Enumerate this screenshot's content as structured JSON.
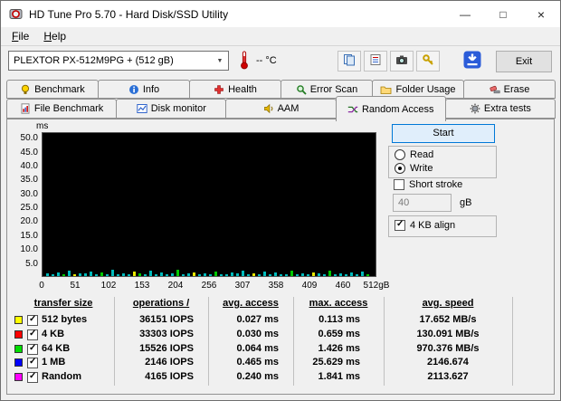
{
  "window": {
    "title": "HD Tune Pro 5.70 - Hard Disk/SSD Utility",
    "controls": {
      "minimize": "—",
      "maximize": "□",
      "close": "×"
    }
  },
  "menu": {
    "items": [
      "File",
      "Help"
    ]
  },
  "toolbar": {
    "drive_selected": "PLEXTOR PX-512M9PG + (512 gB)",
    "temperature": "-- °C",
    "buttons": [
      {
        "name": "copy-to-clipboard-button",
        "icon": "copy-icon"
      },
      {
        "name": "copy-report-button",
        "icon": "report-icon"
      },
      {
        "name": "screenshot-button",
        "icon": "camera-icon"
      },
      {
        "name": "registration-button",
        "icon": "keys-icon"
      }
    ],
    "save_icon": "save-results-icon",
    "exit_label": "Exit"
  },
  "tabs": {
    "row1": [
      {
        "label": "Benchmark",
        "icon": "benchmark-icon"
      },
      {
        "label": "Info",
        "icon": "info-icon"
      },
      {
        "label": "Health",
        "icon": "health-icon"
      },
      {
        "label": "Error Scan",
        "icon": "error-scan-icon"
      },
      {
        "label": "Folder Usage",
        "icon": "folder-usage-icon"
      },
      {
        "label": "Erase",
        "icon": "erase-icon"
      }
    ],
    "row2": [
      {
        "label": "File Benchmark",
        "icon": "file-benchmark-icon"
      },
      {
        "label": "Disk monitor",
        "icon": "disk-monitor-icon"
      },
      {
        "label": "AAM",
        "icon": "aam-icon"
      },
      {
        "label": "Random Access",
        "icon": "random-access-icon",
        "active": true
      },
      {
        "label": "Extra tests",
        "icon": "extra-tests-icon"
      }
    ]
  },
  "controls": {
    "start_label": "Start",
    "read_label": "Read",
    "write_label": "Write",
    "read_selected": false,
    "write_selected": true,
    "short_stroke_label": "Short stroke",
    "short_stroke_checked": false,
    "short_stroke_value": "40",
    "short_stroke_unit": "gB",
    "align_label": "4 KB align",
    "align_checked": true
  },
  "chart_data": {
    "type": "line",
    "title": "Random Access write latency vs disk position",
    "ylabel": "ms",
    "y_ticks": [
      50.0,
      45.0,
      40.0,
      35.0,
      30.0,
      25.0,
      20.0,
      15.0,
      10.0,
      5.0
    ],
    "ylim": [
      0,
      52
    ],
    "x_ticks": [
      "0",
      "51",
      "102",
      "153",
      "204",
      "256",
      "307",
      "358",
      "409",
      "460",
      "512gB"
    ],
    "xlim": [
      0,
      512
    ],
    "grid": false,
    "legend": "none",
    "plot_background": "#000000",
    "note": "access-time spikes hug the baseline, nearly all below 2.5 ms",
    "spike_colors": [
      "#00bcbc",
      "#00c800",
      "#e8e800"
    ],
    "spike_heights_ms": [
      1.0,
      0.6,
      1.4,
      0.8,
      2.0,
      0.5,
      1.1,
      0.9,
      1.6,
      0.7,
      1.3,
      0.6,
      2.2,
      0.8,
      1.0,
      0.5,
      1.5,
      0.9,
      0.6,
      1.8,
      0.7,
      1.2,
      0.5,
      1.0,
      2.4,
      0.6,
      0.9,
      1.4,
      0.7,
      1.1,
      0.5,
      1.7,
      0.8,
      0.6,
      1.3,
      0.9,
      2.0,
      0.5,
      1.0,
      0.7,
      1.5,
      0.6,
      1.2,
      0.8,
      0.5,
      1.9,
      0.7,
      1.1,
      0.6,
      1.4,
      0.9,
      0.5,
      2.1,
      0.8,
      1.0,
      0.6,
      1.3,
      0.7,
      1.6,
      0.5
    ],
    "spike_color_idx": [
      0,
      0,
      0,
      1,
      0,
      2,
      0,
      0,
      0,
      0,
      1,
      0,
      0,
      0,
      0,
      0,
      2,
      1,
      0,
      0,
      0,
      0,
      0,
      0,
      1,
      0,
      0,
      2,
      0,
      0,
      0,
      1,
      0,
      0,
      0,
      0,
      0,
      0,
      2,
      0,
      0,
      0,
      0,
      0,
      0,
      1,
      0,
      0,
      0,
      2,
      0,
      0,
      1,
      0,
      0,
      0,
      0,
      0,
      0,
      1
    ]
  },
  "results": {
    "headers": [
      "transfer size",
      "operations /",
      "avg. access",
      "max. access",
      "avg. speed"
    ],
    "rows": [
      {
        "color": "#ffff00",
        "checked": true,
        "size": "512 bytes",
        "operations": "36151 IOPS",
        "avg_access": "0.027 ms",
        "max_access": "0.113 ms",
        "avg_speed": "17.652 MB/s"
      },
      {
        "color": "#ff0000",
        "checked": true,
        "size": "4 KB",
        "operations": "33303 IOPS",
        "avg_access": "0.030 ms",
        "max_access": "0.659 ms",
        "avg_speed": "130.091 MB/s"
      },
      {
        "color": "#00dd00",
        "checked": true,
        "size": "64 KB",
        "operations": "15526 IOPS",
        "avg_access": "0.064 ms",
        "max_access": "1.426 ms",
        "avg_speed": "970.376 MB/s"
      },
      {
        "color": "#0000ff",
        "checked": true,
        "size": "1 MB",
        "operations": "2146 IOPS",
        "avg_access": "0.465 ms",
        "max_access": "25.629 ms",
        "avg_speed": "2146.674"
      },
      {
        "color": "#ff00ff",
        "checked": true,
        "size": "Random",
        "operations": "4165 IOPS",
        "avg_access": "0.240 ms",
        "max_access": "1.841 ms",
        "avg_speed": "2113.627"
      }
    ]
  }
}
